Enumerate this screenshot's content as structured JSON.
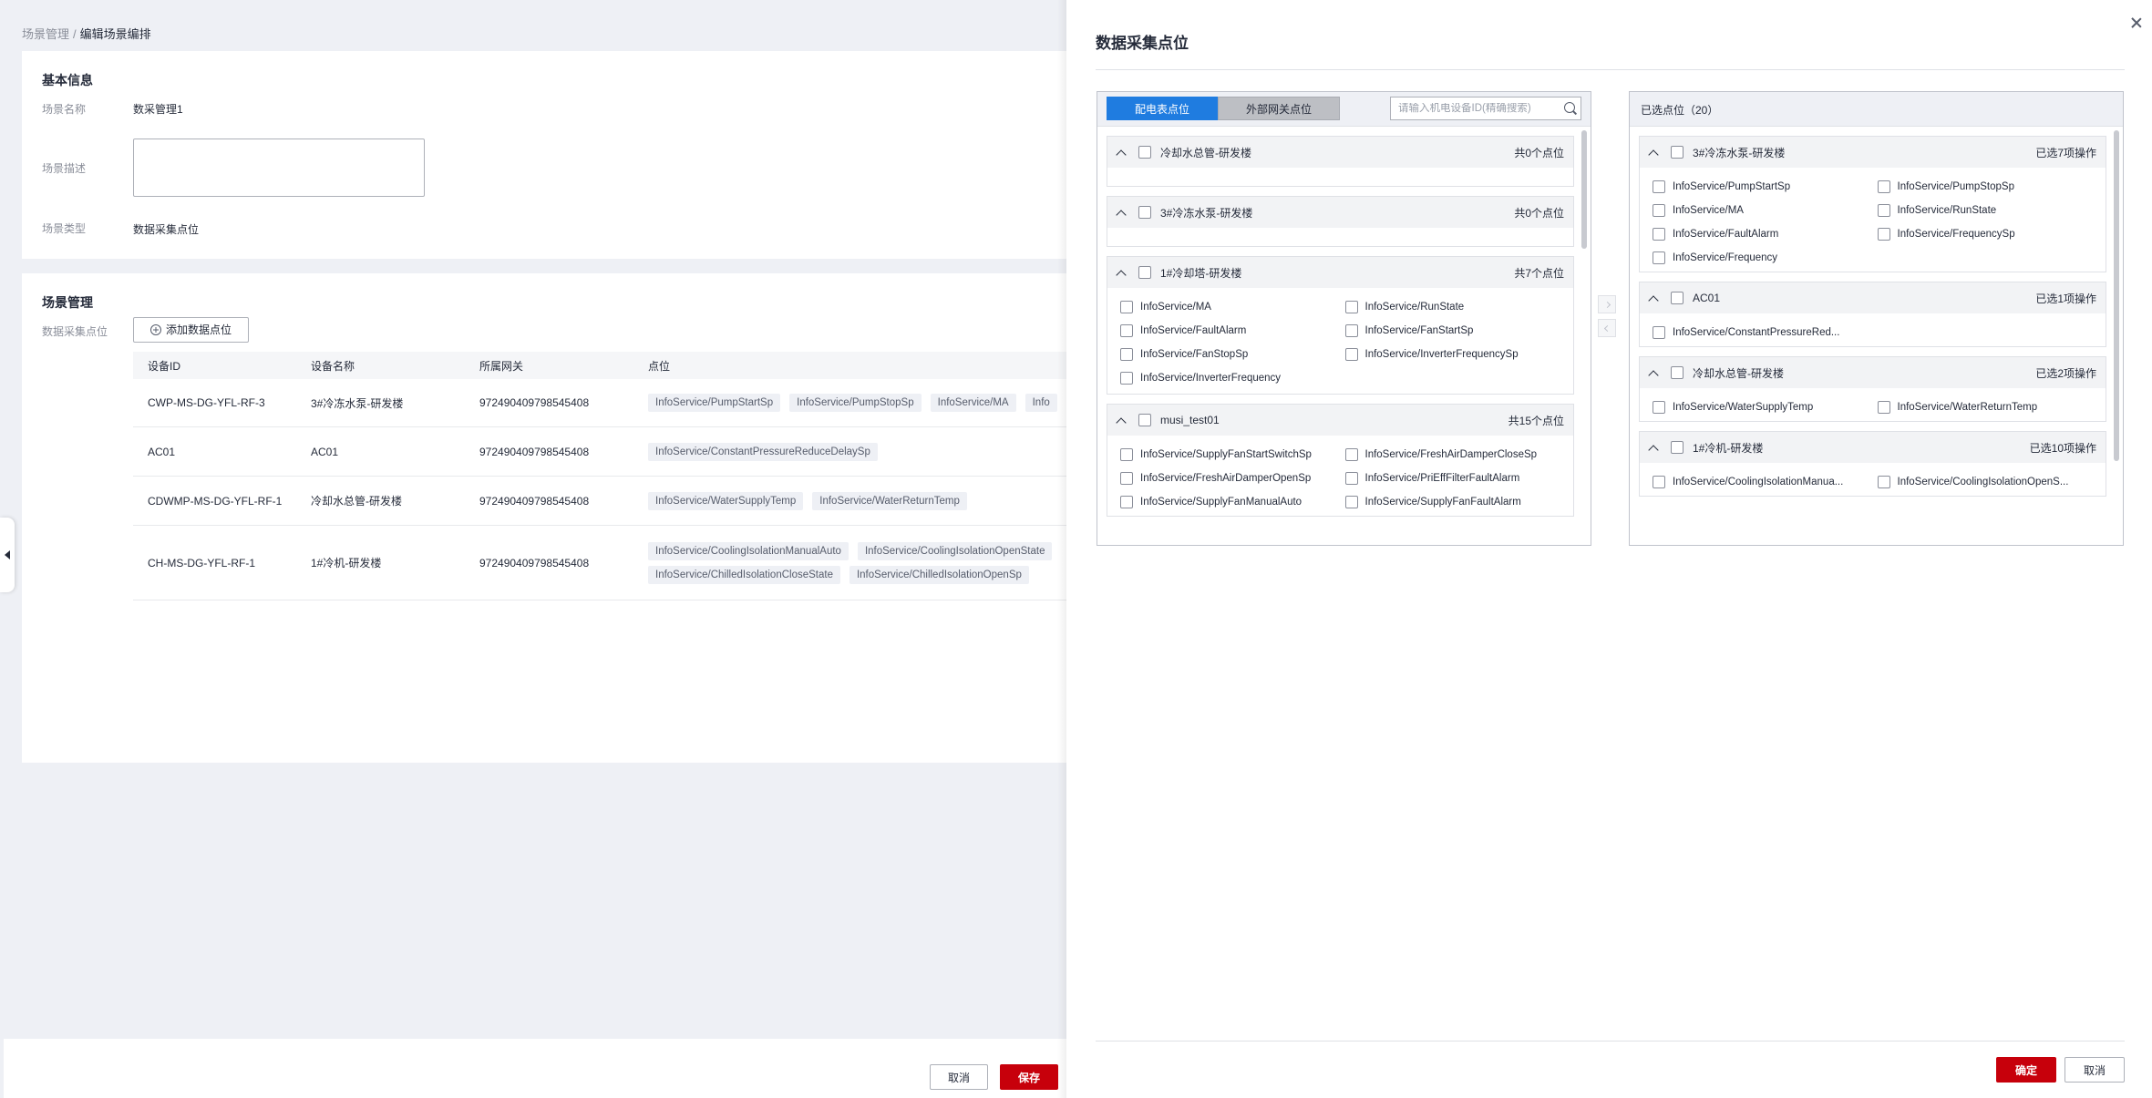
{
  "breadcrumb": {
    "parent": "场景管理",
    "separator": "/",
    "current": "编辑场景编排"
  },
  "basic_info": {
    "title": "基本信息",
    "name_label": "场景名称",
    "name_value": "数采管理1",
    "desc_label": "场景描述",
    "desc_value": "",
    "type_label": "场景类型",
    "type_value": "数据采集点位"
  },
  "scene_mgmt": {
    "title": "场景管理",
    "points_label": "数据采集点位",
    "add_button": "添加数据点位",
    "columns": [
      "设备ID",
      "设备名称",
      "所属网关",
      "点位"
    ],
    "rows": [
      {
        "device_id": "CWP-MS-DG-YFL-RF-3",
        "device_name": "3#冷冻水泵-研发楼",
        "gateway": "972490409798545408",
        "points": [
          "InfoService/PumpStartSp",
          "InfoService/PumpStopSp",
          "InfoService/MA",
          "Info"
        ]
      },
      {
        "device_id": "AC01",
        "device_name": "AC01",
        "gateway": "972490409798545408",
        "points": [
          "InfoService/ConstantPressureReduceDelaySp"
        ]
      },
      {
        "device_id": "CDWMP-MS-DG-YFL-RF-1",
        "device_name": "冷却水总管-研发楼",
        "gateway": "972490409798545408",
        "points": [
          "InfoService/WaterSupplyTemp",
          "InfoService/WaterReturnTemp"
        ]
      },
      {
        "device_id": "CH-MS-DG-YFL-RF-1",
        "device_name": "1#冷机-研发楼",
        "gateway": "972490409798545408",
        "points": [
          "InfoService/CoolingIsolationManualAuto",
          "InfoService/CoolingIsolationOpenState",
          "InfoService/ChilledIsolationCloseState",
          "InfoService/ChilledIsolationOpenSp"
        ]
      }
    ]
  },
  "page_footer": {
    "cancel": "取消",
    "save": "保存"
  },
  "drawer": {
    "title": "数据采集点位",
    "left": {
      "tab_active": "配电表点位",
      "tab_inactive": "外部网关点位",
      "search_placeholder": "请输入机电设备ID(精确搜索)",
      "groups": [
        {
          "name": "冷却水总管-研发楼",
          "count": "共0个点位",
          "items": []
        },
        {
          "name": "3#冷冻水泵-研发楼",
          "count": "共0个点位",
          "items": []
        },
        {
          "name": "1#冷却塔-研发楼",
          "count": "共7个点位",
          "items": [
            "InfoService/MA",
            "InfoService/RunState",
            "InfoService/FaultAlarm",
            "InfoService/FanStartSp",
            "InfoService/FanStopSp",
            "InfoService/InverterFrequencySp",
            "InfoService/InverterFrequency"
          ]
        },
        {
          "name": "musi_test01",
          "count": "共15个点位",
          "items": [
            "InfoService/SupplyFanStartSwitchSp",
            "InfoService/FreshAirDamperCloseSp",
            "InfoService/FreshAirDamperOpenSp",
            "InfoService/PriEffFilterFaultAlarm",
            "InfoService/SupplyFanManualAuto",
            "InfoService/SupplyFanFaultAlarm"
          ]
        }
      ]
    },
    "right": {
      "title": "已选点位（20）",
      "groups": [
        {
          "name": "3#冷冻水泵-研发楼",
          "count": "已选7项操作",
          "items": [
            "InfoService/PumpStartSp",
            "InfoService/PumpStopSp",
            "InfoService/MA",
            "InfoService/RunState",
            "InfoService/FaultAlarm",
            "InfoService/FrequencySp",
            "InfoService/Frequency"
          ]
        },
        {
          "name": "AC01",
          "count": "已选1项操作",
          "items": [
            "InfoService/ConstantPressureRed..."
          ]
        },
        {
          "name": "冷却水总管-研发楼",
          "count": "已选2项操作",
          "items": [
            "InfoService/WaterSupplyTemp",
            "InfoService/WaterReturnTemp"
          ]
        },
        {
          "name": "1#冷机-研发楼",
          "count": "已选10项操作",
          "items": [
            "InfoService/CoolingIsolationManua...",
            "InfoService/CoolingIsolationOpenS..."
          ]
        }
      ]
    },
    "footer": {
      "confirm": "确定",
      "cancel": "取消"
    }
  }
}
